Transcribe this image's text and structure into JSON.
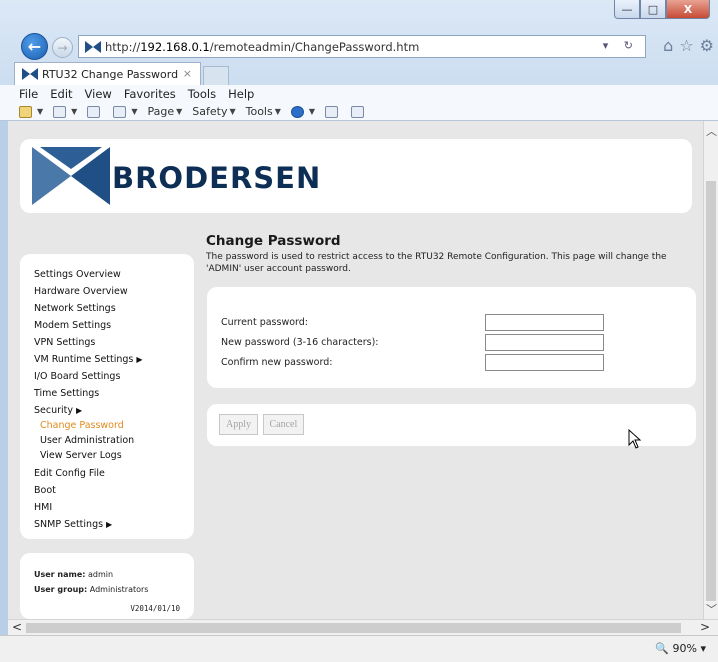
{
  "browser": {
    "url_prefix": "http://",
    "url_host": "192.168.0.1",
    "url_path": "/remoteadmin/ChangePassword.htm",
    "address_tools": "▾ ↻",
    "tab_title": "RTU32 Change Password",
    "tab_close": "×",
    "window": {
      "minimize": "—",
      "maximize": "□",
      "close": "X"
    },
    "menu": [
      "File",
      "Edit",
      "View",
      "Favorites",
      "Tools",
      "Help"
    ],
    "command_bar": {
      "page": "Page",
      "safety": "Safety",
      "tools": "Tools"
    },
    "zoom": "90%"
  },
  "page": {
    "logo_text": "BRODERSEN",
    "sidebar": {
      "items": [
        {
          "label": "Settings Overview"
        },
        {
          "label": "Hardware Overview"
        },
        {
          "label": "Network Settings"
        },
        {
          "label": "Modem Settings"
        },
        {
          "label": "VPN Settings"
        },
        {
          "label": "VM Runtime Settings",
          "has_submenu": true
        },
        {
          "label": "I/O Board Settings"
        },
        {
          "label": "Time Settings"
        },
        {
          "label": "Security",
          "has_submenu": true
        },
        {
          "label": "Edit Config File"
        },
        {
          "label": "Boot"
        },
        {
          "label": "HMI"
        },
        {
          "label": "SNMP Settings",
          "has_submenu": true
        }
      ],
      "security_sub": [
        {
          "label": "Change Password",
          "active": true
        },
        {
          "label": "User Administration"
        },
        {
          "label": "View Server Logs"
        }
      ],
      "submenu_marker": "▶"
    },
    "user": {
      "name_label": "User name:",
      "name": "admin",
      "group_label": "User group:",
      "group": "Administrators",
      "version": "V2014/01/10"
    },
    "content": {
      "title": "Change Password",
      "description": "The password is used to restrict access to the RTU32 Remote Configuration. This page will change the 'ADMIN' user account password."
    },
    "form": {
      "current_label": "Current password:",
      "new_label": "New password (3-16 characters):",
      "confirm_label": "Confirm new password:",
      "current_value": "",
      "new_value": "",
      "confirm_value": ""
    },
    "buttons": {
      "apply": "Apply",
      "cancel": "Cancel"
    }
  },
  "colors": {
    "brand": "#0e2f55",
    "active_link": "#e08a1e",
    "page_bg": "#e7e7e7"
  }
}
